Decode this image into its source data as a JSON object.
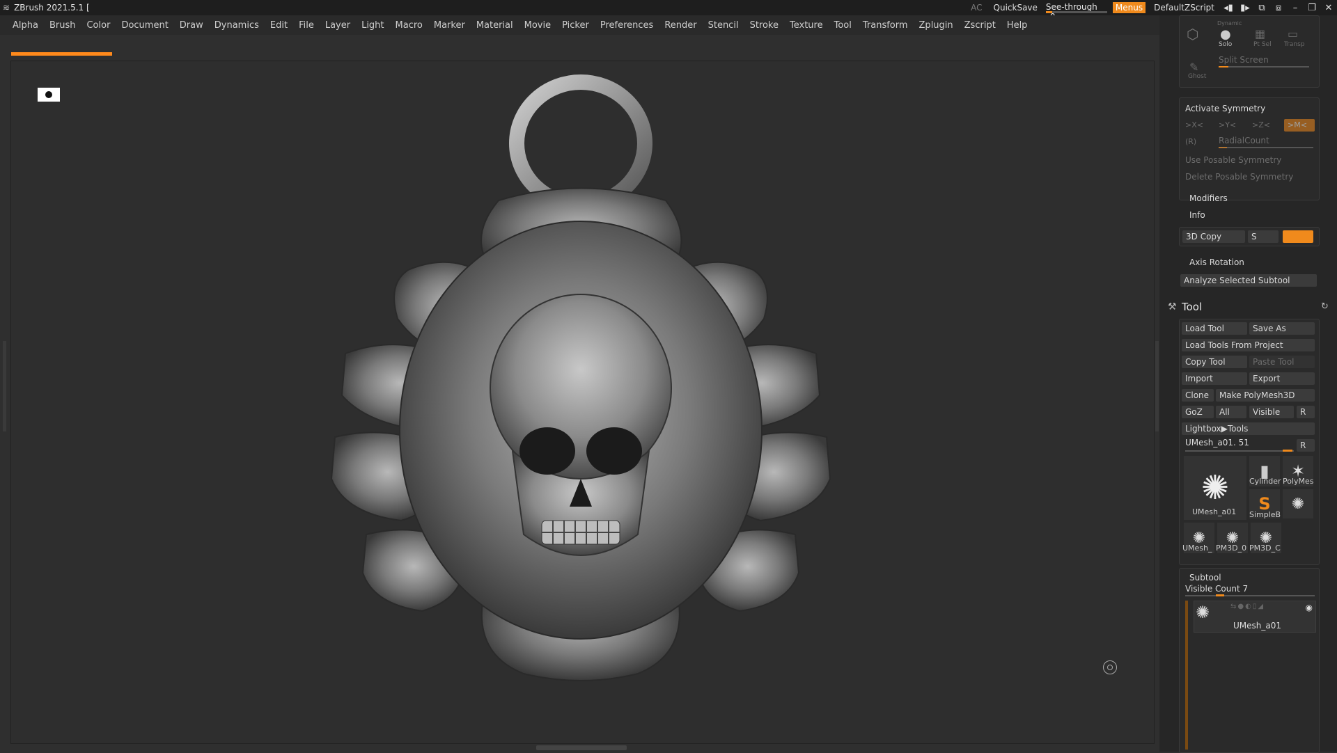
{
  "titlebar": {
    "title": "ZBrush 2021.5.1 [",
    "ac_label": "AC",
    "quicksave_label": "QuickSave",
    "see_through_label": "See-through",
    "see_through_value": "0",
    "see_through_level": 0.1,
    "menus_label": "Menus",
    "script_label": "DefaultZScript"
  },
  "menubar": {
    "items": [
      "Alpha",
      "Brush",
      "Color",
      "Document",
      "Draw",
      "Dynamics",
      "Edit",
      "File",
      "Layer",
      "Light",
      "Macro",
      "Marker",
      "Material",
      "Movie",
      "Picker",
      "Preferences",
      "Render",
      "Stencil",
      "Stroke",
      "Texture",
      "Tool",
      "Transform",
      "Zplugin",
      "Zscript",
      "Help"
    ]
  },
  "top_group": {
    "dynamic_label": "Dynamic",
    "solo_label": "Solo",
    "ptsel_label": "Pt Sel",
    "transp_label": "Transp",
    "ghost_label": "Ghost",
    "split_screen_label": "Split Screen"
  },
  "symmetry": {
    "activate_label": "Activate Symmetry",
    "x_label": ">X<",
    "y_label": ">Y<",
    "z_label": ">Z<",
    "m_label": ">M<",
    "r_label": "(R)",
    "radial_label": "RadialCount",
    "use_posable_label": "Use Posable Symmetry",
    "delete_posable_label": "Delete Posable Symmetry"
  },
  "sections": {
    "modifiers_label": "Modifiers",
    "info_label": "Info",
    "copy3d_label": "3D Copy",
    "s_label": "S",
    "axis_rotation_label": "Axis Rotation",
    "analyze_label": "Analyze Selected Subtool"
  },
  "tool": {
    "header": "Tool",
    "load_tool": "Load Tool",
    "save_as": "Save As",
    "load_from_project": "Load Tools From Project",
    "copy_tool": "Copy Tool",
    "paste_tool": "Paste Tool",
    "import": "Import",
    "export": "Export",
    "clone": "Clone",
    "make_polymesh": "Make PolyMesh3D",
    "goz": "GoZ",
    "all": "All",
    "visible": "Visible",
    "r": "R",
    "lightbox": "Lightbox▶Tools",
    "current_tool": "UMesh_a01. 51",
    "thumbs": [
      "UMesh_a01",
      "Cylinder",
      "PolyMes",
      "SimpleB",
      "UMesh_",
      "PM3D_0",
      "PM3D_C"
    ]
  },
  "subtool": {
    "header": "Subtool",
    "visible_count": "Visible Count 7",
    "item_label": "UMesh_a01"
  },
  "colors": {
    "accent": "#f08a1c",
    "background": "#2f2f2f",
    "panel": "#262626"
  }
}
